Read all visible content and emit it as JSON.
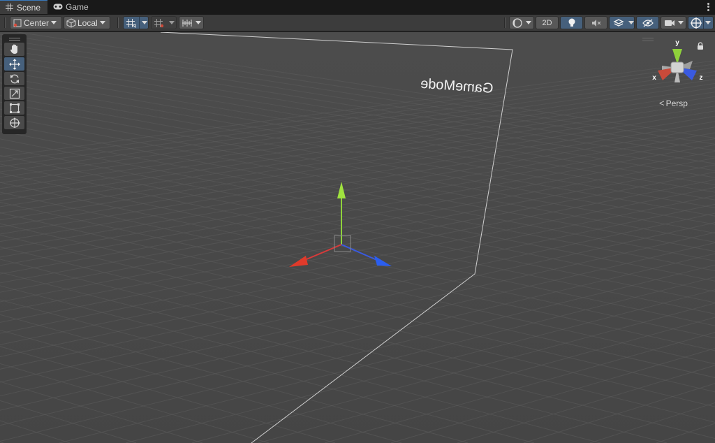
{
  "tabs": [
    {
      "label": "Scene",
      "icon": "scene-grid-icon",
      "active": true
    },
    {
      "label": "Game",
      "icon": "gamepad-icon",
      "active": false
    }
  ],
  "toolbar": {
    "pivot_mode": "Center",
    "pivot_rotation": "Local",
    "mode_2d": "2D"
  },
  "tools": [
    {
      "name": "hand-tool-icon",
      "active": false
    },
    {
      "name": "move-tool-icon",
      "active": true
    },
    {
      "name": "rotate-tool-icon",
      "active": false
    },
    {
      "name": "scale-tool-icon",
      "active": false
    },
    {
      "name": "rect-tool-icon",
      "active": false
    },
    {
      "name": "transform-tool-icon",
      "active": false
    }
  ],
  "scene": {
    "canvas_text": "GameMode",
    "projection": "Persp",
    "gizmo_axes": {
      "x": "x",
      "y": "y",
      "z": "z"
    }
  },
  "colors": {
    "axis_x": "#d83a3a",
    "axis_y": "#8fd13b",
    "axis_z": "#3a5ae0",
    "selection_blue": "#46607c",
    "scene_bg": "#484848"
  }
}
